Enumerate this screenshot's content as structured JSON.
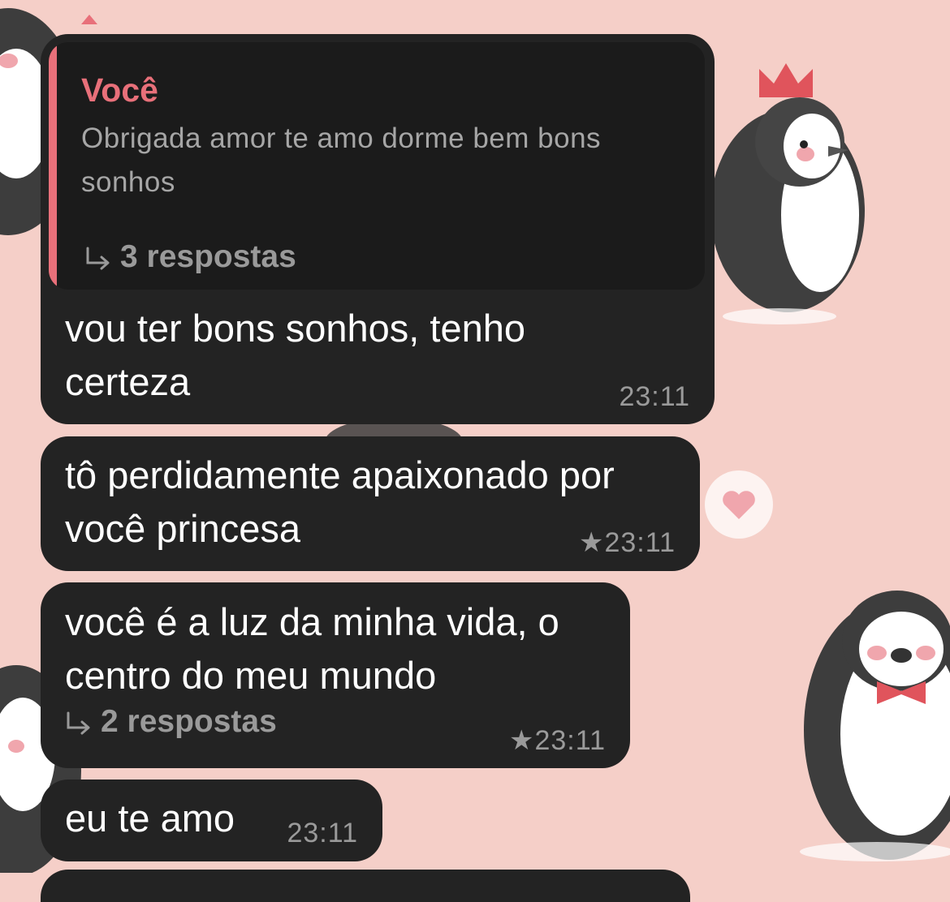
{
  "messages": [
    {
      "quote": {
        "author": "Você",
        "text": "Obrigada amor te amo dorme bem bons sonhos",
        "replies": "3 respostas"
      },
      "text": "vou ter bons sonhos, tenho\ncerteza",
      "time": "23:11",
      "starred": false
    },
    {
      "text": "tô perdidamente apaixonado por\nvocê princesa",
      "time": "23:11",
      "star": "★",
      "starred": true
    },
    {
      "text": "você é a luz da minha vida, o\ncentro do meu mundo",
      "replies": "2 respostas",
      "time": "23:11",
      "star": "★",
      "starred": true
    },
    {
      "text": "eu te amo",
      "time": "23:11",
      "starred": false
    }
  ],
  "colors": {
    "wallpaper": "#f5cfc8",
    "bubble": "#232323",
    "quote_accent": "#e8707a",
    "meta_text": "#9a9a9a"
  },
  "icons": {
    "reply": "reply-arrow-icon",
    "star": "star-icon",
    "wallpaper": "penguin-illustration"
  }
}
